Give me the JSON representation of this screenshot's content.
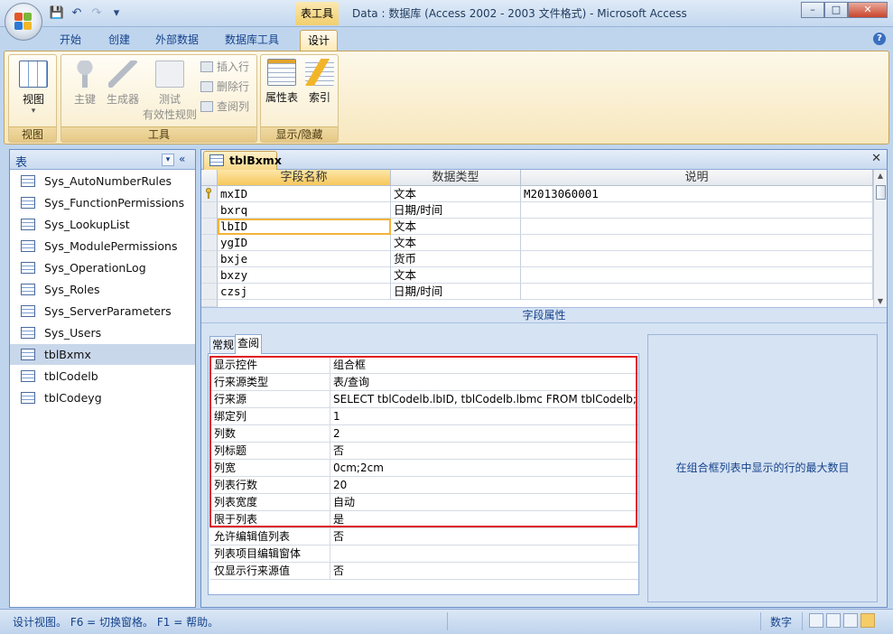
{
  "window": {
    "context_tab": "表工具",
    "title": "Data : 数据库 (Access 2002 - 2003 文件格式) - Microsoft Access",
    "controls": {
      "minimize": "–",
      "maximize": "□",
      "close": "✕"
    }
  },
  "quick_access": {
    "save": "💾",
    "undo": "↶",
    "redo": "↷",
    "customize": "▾"
  },
  "ribbon_tabs": [
    "开始",
    "创建",
    "外部数据",
    "数据库工具",
    "设计"
  ],
  "ribbon": {
    "view_group": {
      "label": "视图",
      "view_button": "视图",
      "view_arrow": "▾"
    },
    "tools_group": {
      "label": "工具",
      "primary_key": "主键",
      "builder": "生成器",
      "test_rules": "测试",
      "test_rules_line2": "有效性规则",
      "insert_row": "插入行",
      "delete_row": "删除行",
      "lookup_column": "查阅列"
    },
    "show_hide_group": {
      "label": "显示/隐藏",
      "property_sheet": "属性表",
      "indexes": "索引"
    }
  },
  "nav_pane": {
    "title": "表",
    "dropdown_glyph": "▾",
    "collapse_glyph": "«",
    "items": [
      "Sys_AutoNumberRules",
      "Sys_FunctionPermissions",
      "Sys_LookupList",
      "Sys_ModulePermissions",
      "Sys_OperationLog",
      "Sys_Roles",
      "Sys_ServerParameters",
      "Sys_Users",
      "tblBxmx",
      "tblCodelb",
      "tblCodeyg"
    ]
  },
  "document": {
    "tab_title": "tblBxmx",
    "close_glyph": "✕",
    "columns": [
      "字段名称",
      "数据类型",
      "说明"
    ],
    "fields": [
      {
        "name": "mxID",
        "type": "文本",
        "desc": "M2013060001"
      },
      {
        "name": "bxrq",
        "type": "日期/时间",
        "desc": ""
      },
      {
        "name": "lbID",
        "type": "文本",
        "desc": ""
      },
      {
        "name": "ygID",
        "type": "文本",
        "desc": ""
      },
      {
        "name": "bxje",
        "type": "货币",
        "desc": ""
      },
      {
        "name": "bxzy",
        "type": "文本",
        "desc": ""
      },
      {
        "name": "czsj",
        "type": "日期/时间",
        "desc": ""
      }
    ],
    "field_properties_label": "字段属性",
    "property_tabs": [
      "常规",
      "查阅"
    ],
    "lookup_properties": [
      {
        "name": "显示控件",
        "value": "组合框"
      },
      {
        "name": "行来源类型",
        "value": "表/查询"
      },
      {
        "name": "行来源",
        "value": "SELECT tblCodelb.lbID, tblCodelb.lbmc FROM tblCodelb;"
      },
      {
        "name": "绑定列",
        "value": "1"
      },
      {
        "name": "列数",
        "value": "2"
      },
      {
        "name": "列标题",
        "value": "否"
      },
      {
        "name": "列宽",
        "value": "0cm;2cm"
      },
      {
        "name": "列表行数",
        "value": "20"
      },
      {
        "name": "列表宽度",
        "value": "自动"
      },
      {
        "name": "限于列表",
        "value": "是"
      },
      {
        "name": "允许编辑值列表",
        "value": "否"
      },
      {
        "name": "列表项目编辑窗体",
        "value": ""
      },
      {
        "name": "仅显示行来源值",
        "value": "否"
      }
    ],
    "help_text": "在组合框列表中显示的行的最大数目"
  },
  "status_bar": {
    "text": "设计视图。 F6 = 切换窗格。 F1 = 帮助。",
    "mode": "数字"
  },
  "colors": {
    "ribbon_active": "#f7d889",
    "highlight_border": "#e0181c",
    "frame_blue": "#6b8fc4"
  }
}
